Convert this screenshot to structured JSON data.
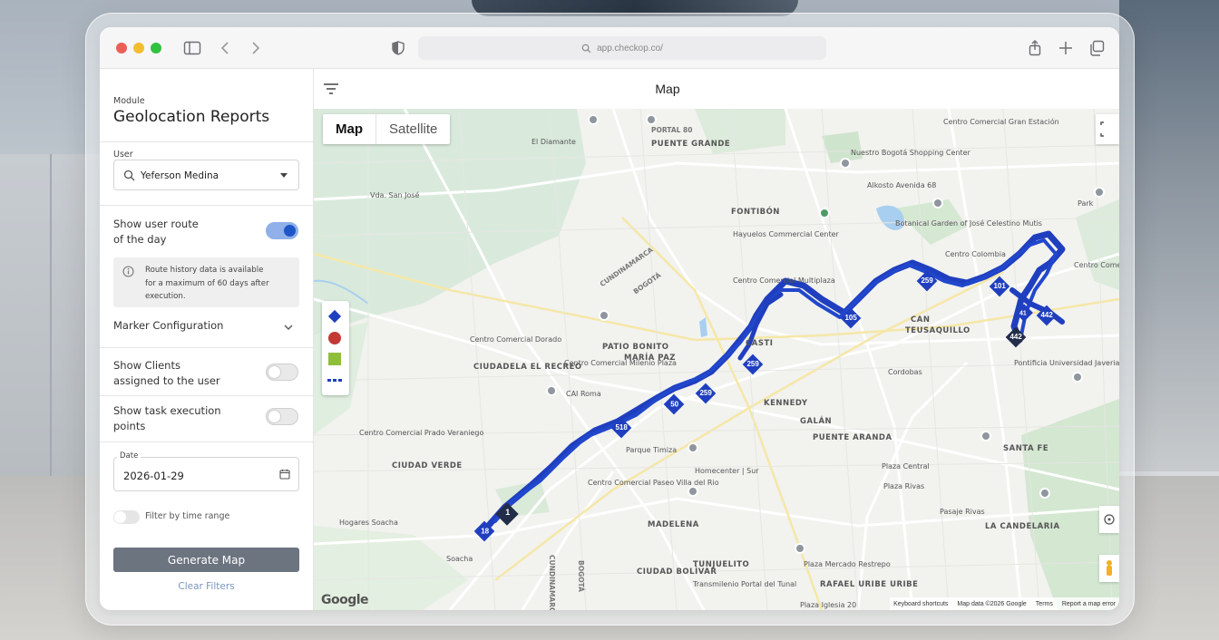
{
  "browser": {
    "url": "app.checkop.co/"
  },
  "panel": {
    "module_label": "Module",
    "module_title": "Geolocation Reports",
    "user_label": "User",
    "user_value": "Yeferson Medina",
    "show_route_line1": "Show user route",
    "show_route_line2": "of the day",
    "show_route_on": true,
    "info_line1": "Route history data is available",
    "info_line2": "for a maximum of 60 days after",
    "info_line3": "execution.",
    "marker_config": "Marker Configuration",
    "show_clients_line1": "Show Clients",
    "show_clients_line2": "assigned to the user",
    "show_clients_on": false,
    "show_task_line1": "Show task execution",
    "show_task_line2": "points",
    "show_task_on": false,
    "date_label": "Date",
    "date_value": "2026-01-29",
    "filter_time_label": "Filter by time range",
    "generate_button": "Generate Map",
    "clear_button": "Clear Filters"
  },
  "map": {
    "title": "Map",
    "type_map": "Map",
    "type_satellite": "Satellite",
    "google": "Google",
    "attribution": {
      "shortcuts": "Keyboard shortcuts",
      "data": "Map data ©2026 Google",
      "terms": "Terms",
      "report": "Report a map error"
    },
    "labels": {
      "el_diamante": "El Diamante",
      "portal_80": "PORTAL 80",
      "puente_grande": "PUENTE GRANDE",
      "vda_san_jose": "Vda. San José",
      "fontibon": "FONTIBÓN",
      "cundinamarca": "CUNDINAMARCA",
      "bogota_road": "BOGOTÁ",
      "centro_dorado": "Centro Comercial Dorado",
      "ciudadela_recreo": "CIUDADELA EL RECREO",
      "patio_bonito": "PATIO BONITO",
      "maria_paz": "MARÍA PAZ",
      "milenio_plaza": "Centro Comercial Milenio Plaza",
      "cai_roma": "CAI Roma",
      "kennedy": "KENNEDY",
      "castilla": "CASTI",
      "centro_multiplaza": "Centro Comercial Multiplaza",
      "hayuelos": "Hayuelos Commercial Center",
      "centro_comercial": "Centro Comercial",
      "nuestro_bogota": "Nuestro Bogotá Shopping Center",
      "alkosto": "Alkosto Avenida 68",
      "botanical": "Botanical Garden of José Celestino Mutis",
      "gran_estacion": "Centro Comercial Gran Estación",
      "centro_colombia": "Centro Colombia",
      "can": "CAN",
      "teusaquillo": "TEUSAQUILLO",
      "park": "Park",
      "cordobas": "Cordobas",
      "javeriana": "Pontificia Universidad Javeriana",
      "galan": "GALÁN",
      "puente_aranda": "PUENTE ARANDA",
      "santa_fe": "SANTA FE",
      "plaza_central": "Plaza Central",
      "plaza_rivas": "Plaza Rivas",
      "pasaje_rivas": "Pasaje Rivas",
      "candelaria": "LA CANDELARIA",
      "parque_timiza": "Parque Timiza",
      "centro_plaza_recreo": "Centro Comercial Prado Veraniego",
      "ciudad_verde": "CIUDAD VERDE",
      "homecenter": "Homecenter | Sur",
      "paseo_villa": "Centro Comercial Paseo Villa del Rio",
      "madelena": "MADELENA",
      "hogares_soacha": "Hogares Soacha",
      "soacha": "Soacha",
      "tunjuelito": "TUNJUELITO",
      "plaza_restrepo": "Plaza Mercado Restrepo",
      "ciudad_bolivar": "CIUDAD BOLÍVAR",
      "transmilenio": "Transmilenio Portal del Tunal",
      "rafael_uribe": "RAFAEL URIBE URIBE",
      "plaza_iglesia": "Plaza Iglesia 20",
      "cundinamarca_v": "CUNDINAMARCA",
      "bogota_v": "BOGOTÁ"
    },
    "pins": [
      "1",
      "18",
      "518",
      "50",
      "259",
      "259",
      "105",
      "101",
      "259",
      "442",
      "442",
      "41"
    ],
    "legend_colors": [
      "#1f3fbf",
      "#c23a33",
      "#8fbf3a",
      "#1f3fbf"
    ],
    "route_color": "#1f3fbf"
  }
}
